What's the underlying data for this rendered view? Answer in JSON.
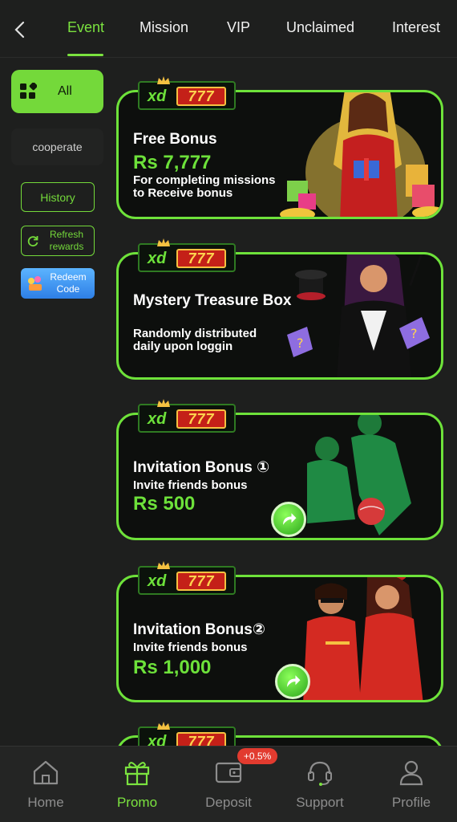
{
  "colors": {
    "accent": "#74d93a",
    "background": "#1e1f1e",
    "card_border": "#6ee23a",
    "badge": "#e23b2f"
  },
  "topbar": {
    "back_icon": "chevron-left-icon",
    "tabs": [
      {
        "label": "Event",
        "active": true
      },
      {
        "label": "Mission",
        "active": false
      },
      {
        "label": "VIP",
        "active": false
      },
      {
        "label": "Unclaimed",
        "active": false
      },
      {
        "label": "Interest",
        "active": false
      }
    ]
  },
  "sidebar": {
    "all_label": "All",
    "all_icon": "grid-icon",
    "cooperate_label": "cooperate",
    "history_label": "History",
    "refresh_label": "Refresh rewards",
    "redeem_label": "Redeem Code"
  },
  "cards": [
    {
      "logo_xd": "xd",
      "logo_num": "777",
      "title": "Free Bonus",
      "amount": "Rs 7,777",
      "desc": "For completing missions to Receive bonus"
    },
    {
      "logo_xd": "xd",
      "logo_num": "777",
      "title": "Mystery Treasure Box",
      "desc": "Randomly distributed daily upon loggin"
    },
    {
      "logo_xd": "xd",
      "logo_num": "777",
      "title": "Invitation Bonus ①",
      "desc": "Invite friends bonus",
      "amount": "Rs 500"
    },
    {
      "logo_xd": "xd",
      "logo_num": "777",
      "title": "Invitation Bonus②",
      "desc": "Invite friends bonus",
      "amount": "Rs 1,000"
    },
    {
      "logo_xd": "xd",
      "logo_num": "777"
    }
  ],
  "bottomnav": {
    "items": [
      {
        "label": "Home",
        "icon": "home-icon",
        "active": false
      },
      {
        "label": "Promo",
        "icon": "gift-icon",
        "active": true
      },
      {
        "label": "Deposit",
        "icon": "wallet-icon",
        "active": false
      },
      {
        "label": "Support",
        "icon": "headset-icon",
        "active": false
      },
      {
        "label": "Profile",
        "icon": "user-icon",
        "active": false
      }
    ],
    "deposit_badge": "+0.5%"
  }
}
